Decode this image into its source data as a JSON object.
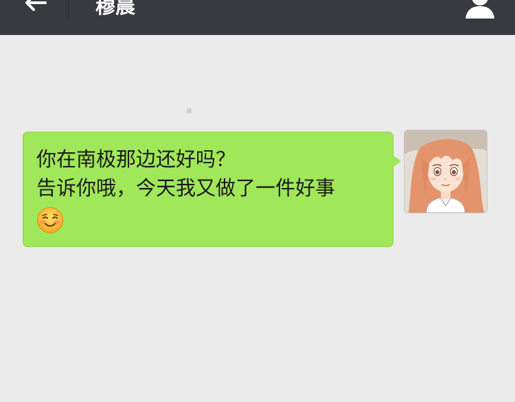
{
  "header": {
    "title": "穆晨",
    "back_icon": "back-arrow-icon",
    "profile_icon": "person-icon",
    "bar_color": "#393a3f"
  },
  "chat": {
    "background_color": "#ebebeb",
    "messages": [
      {
        "sender": "self",
        "lines": [
          "你在南极那边还好吗？",
          "告诉你哦，今天我又做了一件好事"
        ],
        "emoji": "smiling-face-emoji",
        "bubble_color": "#a0e75a"
      }
    ]
  }
}
